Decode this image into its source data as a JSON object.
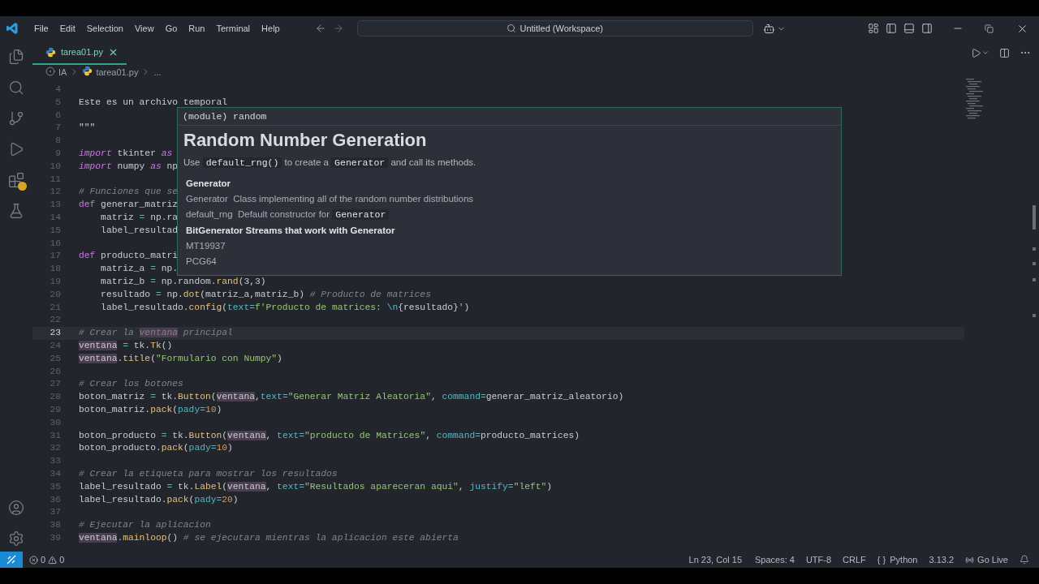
{
  "title_bar": {
    "menu": [
      "File",
      "Edit",
      "Selection",
      "View",
      "Go",
      "Run",
      "Terminal",
      "Help"
    ],
    "search": "Untitled (Workspace)"
  },
  "tabs": [
    {
      "label": "tarea01.py",
      "selected": true
    }
  ],
  "breadcrumb": [
    "IA",
    "tarea01.py",
    "..."
  ],
  "editor": {
    "lines": [
      {
        "n": "4",
        "active": false
      },
      {
        "n": "5",
        "active": false,
        "tokens": [
          {
            "kind": "plain",
            "text": "Este es un archivo temporal"
          }
        ]
      },
      {
        "n": "6",
        "active": false
      },
      {
        "n": "7",
        "active": false,
        "tokens": [
          {
            "kind": "plain",
            "text": "\"\"\""
          }
        ]
      },
      {
        "n": "8",
        "active": false
      },
      {
        "n": "9",
        "active": false,
        "tokens": [
          {
            "kind": "import",
            "text": "import"
          },
          {
            "kind": "plain",
            "text": " tkinter "
          },
          {
            "kind": "import",
            "text": "as"
          }
        ]
      },
      {
        "n": "10",
        "active": false,
        "tokens": [
          {
            "kind": "import",
            "text": "import"
          },
          {
            "kind": "plain",
            "text": " numpy "
          },
          {
            "kind": "import",
            "text": "as"
          },
          {
            "kind": "plain",
            "text": " np"
          }
        ]
      },
      {
        "n": "11",
        "active": false
      },
      {
        "n": "12",
        "active": false,
        "tokens": [
          {
            "kind": "comment",
            "text": "# Funciones que se"
          }
        ]
      },
      {
        "n": "13",
        "active": false,
        "tokens": [
          {
            "kind": "keyword",
            "text": "def"
          },
          {
            "kind": "plain",
            "text": " generar_matriz"
          }
        ]
      },
      {
        "n": "14",
        "active": false,
        "tokens": [
          {
            "kind": "plain",
            "text": "    matriz "
          },
          {
            "kind": "operator",
            "text": "="
          },
          {
            "kind": "plain",
            "text": " np.ra"
          }
        ]
      },
      {
        "n": "15",
        "active": false,
        "tokens": [
          {
            "kind": "plain",
            "text": "    label_resultad"
          }
        ]
      },
      {
        "n": "16",
        "active": false
      },
      {
        "n": "17",
        "active": false,
        "tokens": [
          {
            "kind": "keyword",
            "text": "def"
          },
          {
            "kind": "plain",
            "text": " producto_matri"
          }
        ]
      },
      {
        "n": "18",
        "active": false,
        "tokens": [
          {
            "kind": "plain",
            "text": "    matriz_a "
          },
          {
            "kind": "operator",
            "text": "="
          },
          {
            "kind": "plain",
            "text": " np."
          }
        ]
      },
      {
        "n": "19",
        "active": false,
        "tokens": [
          {
            "kind": "plain",
            "text": "    matriz_b "
          },
          {
            "kind": "operator",
            "text": "="
          },
          {
            "kind": "plain",
            "text": " np.random."
          },
          {
            "kind": "function",
            "text": "rand"
          },
          {
            "kind": "plain",
            "text": "(3,3)"
          }
        ]
      },
      {
        "n": "20",
        "active": false,
        "tokens": [
          {
            "kind": "plain",
            "text": "    resultado "
          },
          {
            "kind": "operator",
            "text": "="
          },
          {
            "kind": "plain",
            "text": " np."
          },
          {
            "kind": "function",
            "text": "dot"
          },
          {
            "kind": "plain",
            "text": "(matriz_a,matriz_b) "
          },
          {
            "kind": "comment",
            "text": "# Producto de matrices"
          }
        ]
      },
      {
        "n": "21",
        "active": false,
        "tokens": [
          {
            "kind": "plain",
            "text": "    label_resultado."
          },
          {
            "kind": "function",
            "text": "config"
          },
          {
            "kind": "plain",
            "text": "("
          },
          {
            "kind": "param",
            "text": "text"
          },
          {
            "kind": "operator",
            "text": "="
          },
          {
            "kind": "string",
            "text": "f'Producto de matrices: "
          },
          {
            "kind": "param",
            "text": "\\n"
          },
          {
            "kind": "plain",
            "text": "{resultado}"
          },
          {
            "kind": "string",
            "text": "'"
          },
          {
            "kind": "plain",
            "text": ")"
          }
        ]
      },
      {
        "n": "22",
        "active": false
      },
      {
        "n": "23",
        "active": true,
        "tokens": [
          {
            "kind": "comment",
            "text": "# Crear la "
          },
          {
            "kind": "comment_match",
            "text": "ventana"
          },
          {
            "kind": "comment",
            "text": " principal"
          }
        ]
      },
      {
        "n": "24",
        "active": false,
        "tokens": [
          {
            "kind": "match",
            "text": "ventana"
          },
          {
            "kind": "operator",
            "text": " ="
          },
          {
            "kind": "plain",
            "text": " tk."
          },
          {
            "kind": "function",
            "text": "Tk"
          },
          {
            "kind": "plain",
            "text": "()"
          }
        ]
      },
      {
        "n": "25",
        "active": false,
        "tokens": [
          {
            "kind": "match",
            "text": "ventana"
          },
          {
            "kind": "plain",
            "text": "."
          },
          {
            "kind": "function",
            "text": "title"
          },
          {
            "kind": "plain",
            "text": "("
          },
          {
            "kind": "string",
            "text": "\"Formulario con Numpy\""
          },
          {
            "kind": "plain",
            "text": ")"
          }
        ]
      },
      {
        "n": "26",
        "active": false
      },
      {
        "n": "27",
        "active": false,
        "tokens": [
          {
            "kind": "comment",
            "text": "# Crear los botones"
          }
        ]
      },
      {
        "n": "28",
        "active": false,
        "tokens": [
          {
            "kind": "plain",
            "text": "boton_matriz "
          },
          {
            "kind": "operator",
            "text": "="
          },
          {
            "kind": "plain",
            "text": " tk."
          },
          {
            "kind": "function",
            "text": "Button"
          },
          {
            "kind": "plain",
            "text": "("
          },
          {
            "kind": "match",
            "text": "ventana"
          },
          {
            "kind": "plain",
            "text": ","
          },
          {
            "kind": "param",
            "text": "text"
          },
          {
            "kind": "operator",
            "text": "="
          },
          {
            "kind": "string",
            "text": "\"Generar Matriz Aleatoria\""
          },
          {
            "kind": "plain",
            "text": ", "
          },
          {
            "kind": "param",
            "text": "command"
          },
          {
            "kind": "operator",
            "text": "="
          },
          {
            "kind": "plain",
            "text": "generar_matriz_aleatorio)"
          }
        ]
      },
      {
        "n": "29",
        "active": false,
        "tokens": [
          {
            "kind": "plain",
            "text": "boton_matriz."
          },
          {
            "kind": "function",
            "text": "pack"
          },
          {
            "kind": "plain",
            "text": "("
          },
          {
            "kind": "param",
            "text": "pady"
          },
          {
            "kind": "operator",
            "text": "="
          },
          {
            "kind": "number",
            "text": "10"
          },
          {
            "kind": "plain",
            "text": ")"
          }
        ]
      },
      {
        "n": "30",
        "active": false
      },
      {
        "n": "31",
        "active": false,
        "tokens": [
          {
            "kind": "plain",
            "text": "boton_producto "
          },
          {
            "kind": "operator",
            "text": "="
          },
          {
            "kind": "plain",
            "text": " tk."
          },
          {
            "kind": "function",
            "text": "Button"
          },
          {
            "kind": "plain",
            "text": "("
          },
          {
            "kind": "match",
            "text": "ventana"
          },
          {
            "kind": "plain",
            "text": ", "
          },
          {
            "kind": "param",
            "text": "text"
          },
          {
            "kind": "operator",
            "text": "="
          },
          {
            "kind": "string",
            "text": "\"producto de Matrices\""
          },
          {
            "kind": "plain",
            "text": ", "
          },
          {
            "kind": "param",
            "text": "command"
          },
          {
            "kind": "operator",
            "text": "="
          },
          {
            "kind": "plain",
            "text": "producto_matrices)"
          }
        ]
      },
      {
        "n": "32",
        "active": false,
        "tokens": [
          {
            "kind": "plain",
            "text": "boton_producto."
          },
          {
            "kind": "function",
            "text": "pack"
          },
          {
            "kind": "plain",
            "text": "("
          },
          {
            "kind": "param",
            "text": "pady"
          },
          {
            "kind": "operator",
            "text": "="
          },
          {
            "kind": "number",
            "text": "10"
          },
          {
            "kind": "plain",
            "text": ")"
          }
        ]
      },
      {
        "n": "33",
        "active": false
      },
      {
        "n": "34",
        "active": false,
        "tokens": [
          {
            "kind": "comment",
            "text": "# Crear la etiqueta para mostrar los resultados"
          }
        ]
      },
      {
        "n": "35",
        "active": false,
        "tokens": [
          {
            "kind": "plain",
            "text": "label_resultado "
          },
          {
            "kind": "operator",
            "text": "="
          },
          {
            "kind": "plain",
            "text": " tk."
          },
          {
            "kind": "function",
            "text": "Label"
          },
          {
            "kind": "plain",
            "text": "("
          },
          {
            "kind": "match",
            "text": "ventana"
          },
          {
            "kind": "plain",
            "text": ", "
          },
          {
            "kind": "param",
            "text": "text"
          },
          {
            "kind": "operator",
            "text": "="
          },
          {
            "kind": "string",
            "text": "\"Resultados apareceran aqui\""
          },
          {
            "kind": "plain",
            "text": ", "
          },
          {
            "kind": "param",
            "text": "justify"
          },
          {
            "kind": "operator",
            "text": "="
          },
          {
            "kind": "string",
            "text": "\"left\""
          },
          {
            "kind": "plain",
            "text": ")"
          }
        ]
      },
      {
        "n": "36",
        "active": false,
        "tokens": [
          {
            "kind": "plain",
            "text": "label_resultado."
          },
          {
            "kind": "function",
            "text": "pack"
          },
          {
            "kind": "plain",
            "text": "("
          },
          {
            "kind": "param",
            "text": "pady"
          },
          {
            "kind": "operator",
            "text": "="
          },
          {
            "kind": "number",
            "text": "20"
          },
          {
            "kind": "plain",
            "text": ")"
          }
        ]
      },
      {
        "n": "37",
        "active": false
      },
      {
        "n": "38",
        "active": false,
        "tokens": [
          {
            "kind": "comment",
            "text": "# Ejecutar la aplicacion"
          }
        ]
      },
      {
        "n": "39",
        "active": false,
        "tokens": [
          {
            "kind": "match",
            "text": "ventana"
          },
          {
            "kind": "plain",
            "text": "."
          },
          {
            "kind": "function",
            "text": "mainloop"
          },
          {
            "kind": "plain",
            "text": "() "
          },
          {
            "kind": "comment",
            "text": "# se ejecutara mientras la aplicacion este abierta"
          }
        ]
      }
    ]
  },
  "hover": {
    "signature": "(module) random",
    "heading": "Random Number Generation",
    "intro": [
      {
        "text": "Use ",
        "code": false
      },
      {
        "text": "default_rng()",
        "code": true
      },
      {
        "text": " to create a ",
        "code": false
      },
      {
        "text": "Generator",
        "code": true
      },
      {
        "text": " and call its methods.",
        "code": false
      }
    ],
    "section_1": "Generator",
    "entries": [
      {
        "name": "Generator",
        "desc": "Class implementing all of the random number distributions"
      },
      {
        "name": "default_rng",
        "desc": "Default constructor for",
        "code": "Generator"
      }
    ],
    "section_2": "BitGenerator Streams that work with Generator",
    "streams": [
      "MT19937",
      "PCG64"
    ]
  },
  "status_bar": {
    "errors": "0",
    "warnings": "0",
    "position": "Ln 23, Col 15",
    "spaces": "Spaces: 4",
    "encoding": "UTF-8",
    "eol": "CRLF",
    "language_icon": "{ }",
    "language": "Python",
    "version": "3.13.2",
    "live": "Go Live"
  }
}
